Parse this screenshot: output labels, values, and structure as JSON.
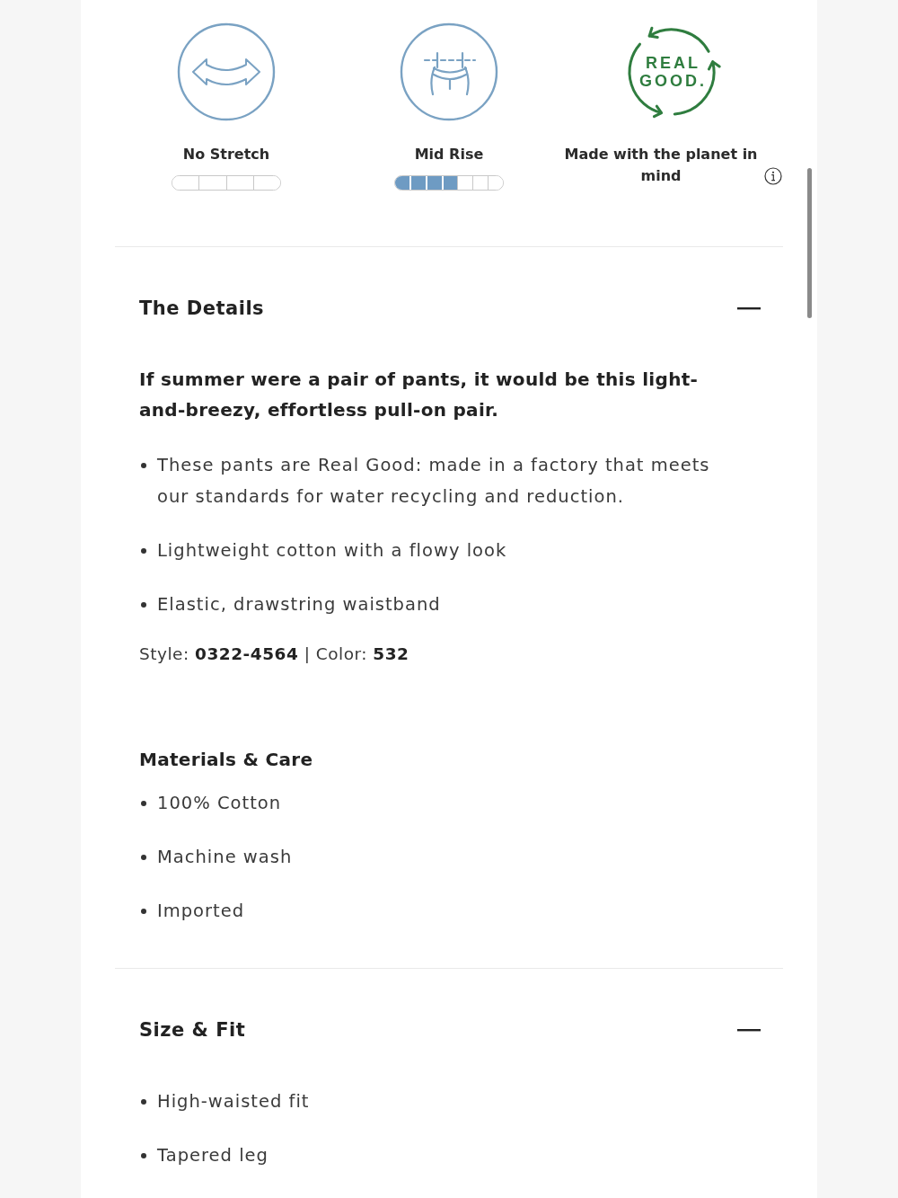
{
  "features": [
    {
      "kind": "stretch",
      "label": "No Stretch",
      "segments": [
        {
          "filled": false
        },
        {
          "filled": false
        },
        {
          "filled": false
        },
        {
          "filled": false
        }
      ]
    },
    {
      "kind": "rise",
      "label": "Mid Rise",
      "segments": [
        {
          "filled": true
        },
        {
          "filled": true
        },
        {
          "filled": true
        },
        {
          "filled": true
        },
        {
          "filled": false
        },
        {
          "filled": false
        },
        {
          "filled": false
        }
      ]
    },
    {
      "kind": "badge",
      "logo": [
        "REAL",
        "GOOD."
      ],
      "label": "Made with the planet in mind"
    }
  ],
  "sections": [
    {
      "title": "The Details",
      "expanded": true,
      "lead": "If summer were a pair of pants, it would be this light-and-breezy, effortless pull-on pair.",
      "bullets": [
        "These pants are Real Good: made in a factory that meets our standards for water recycling and reduction.",
        "Lightweight cotton with a flowy look",
        "Elastic, drawstring waistband"
      ],
      "style_line": "Style: **0322-4564** | Color: **532**",
      "subsections": [
        {
          "title": "Materials & Care",
          "bullets": [
            "100% Cotton",
            "Machine wash",
            "Imported"
          ]
        }
      ]
    },
    {
      "title": "Size & Fit",
      "expanded": true,
      "bullets": [
        "High-waisted fit",
        "Tapered leg"
      ]
    }
  ]
}
